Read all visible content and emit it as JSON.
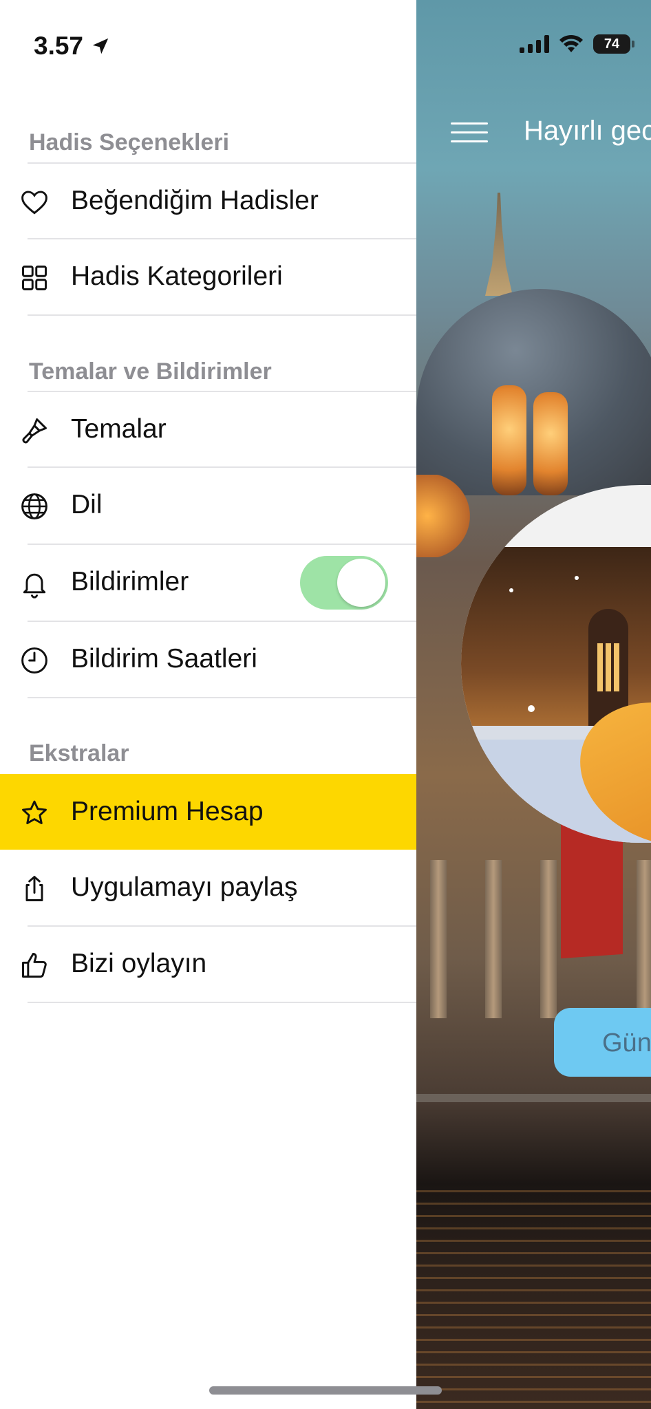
{
  "status_bar": {
    "time": "3.57",
    "battery": "74"
  },
  "drawer": {
    "sections": [
      {
        "title": "Hadis Seçenekleri",
        "items": [
          {
            "label": "Beğendiğim Hadisler",
            "icon": "heart-icon"
          },
          {
            "label": "Hadis Kategorileri",
            "icon": "grid-icon"
          }
        ]
      },
      {
        "title": "Temalar ve Bildirimler",
        "items": [
          {
            "label": "Temalar",
            "icon": "paintbrush-icon"
          },
          {
            "label": "Dil",
            "icon": "globe-icon"
          },
          {
            "label": "Bildirimler",
            "icon": "bell-icon",
            "toggle": true
          },
          {
            "label": "Bildirim Saatleri",
            "icon": "clock-icon"
          }
        ]
      },
      {
        "title": "Ekstralar",
        "items": [
          {
            "label": "Premium Hesap",
            "icon": "star-icon",
            "highlight": "#FDD700"
          },
          {
            "label": "Uygulamayı paylaş",
            "icon": "share-icon"
          },
          {
            "label": "Bizi oylayın",
            "icon": "thumbs-up-icon"
          }
        ]
      }
    ]
  },
  "background_app": {
    "greeting": "Hayırlı gec",
    "button": "Gün"
  },
  "colors": {
    "premium_highlight": "#FDD700",
    "toggle_on": "#9EE3A6",
    "section_title": "#8E8E93"
  }
}
